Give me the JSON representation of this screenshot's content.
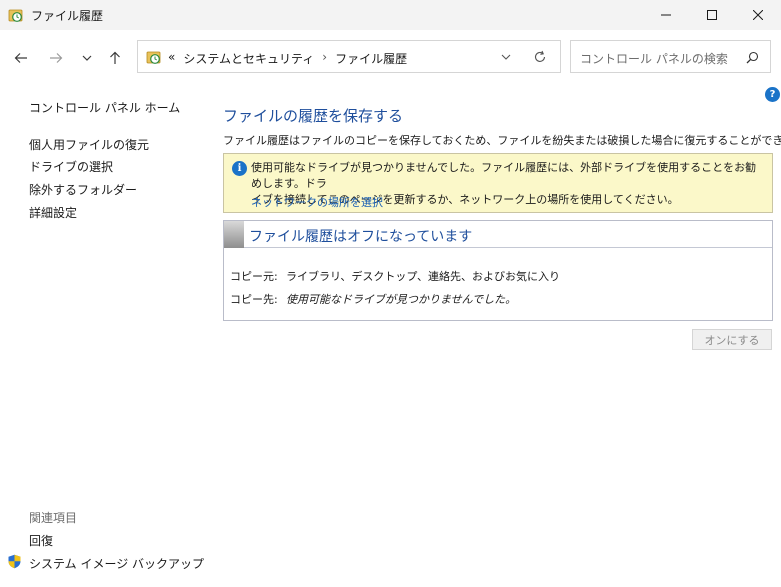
{
  "window": {
    "title": "ファイル履歴",
    "controls": [
      "minimize-icon",
      "maximize-icon",
      "close-icon"
    ]
  },
  "navigation": {
    "back_icon": "arrow-left-icon",
    "forward_icon": "arrow-right-icon",
    "recent_icon": "chevron-down-icon",
    "up_icon": "arrow-up-icon",
    "breadcrumb": {
      "overflow": "«",
      "items": [
        "システムとセキュリティ",
        "ファイル履歴"
      ],
      "separator": "›"
    },
    "search_placeholder": "コントロール パネルの検索"
  },
  "sidebar": {
    "home": "コントロール パネル ホーム",
    "items": [
      "個人用ファイルの復元",
      "ドライブの選択",
      "除外するフォルダー",
      "詳細設定"
    ],
    "related_title": "関連項目",
    "related_items": [
      "回復",
      "システム イメージ バックアップ"
    ]
  },
  "main": {
    "help": "?",
    "title": "ファイルの履歴を保存する",
    "description": "ファイル履歴はファイルのコピーを保存しておくため、ファイルを紛失または破損した場合に復元することができます。",
    "info": {
      "line1": "使用可能なドライブが見つかりませんでした。ファイル履歴には、外部ドライブを使用することをお勧めします。ドラ",
      "line2": "イブを接続してこのページを更新するか、ネットワーク上の場所を使用してください。",
      "link": "ネットワークの場所を選択"
    },
    "status": {
      "title": "ファイル履歴はオフになっています",
      "copy_from_label": "コピー元:",
      "copy_from_value": "ライブラリ、デスクトップ、連絡先、およびお気に入り",
      "copy_to_label": "コピー先:",
      "copy_to_value": "使用可能なドライブが見つかりませんでした。"
    },
    "turn_on_button": "オンにする"
  },
  "colors": {
    "title_blue": "#1e4e9c",
    "link_blue": "#1a5fb4",
    "info_bg": "#fbf8c9",
    "titlebar_bg": "#f3f3f3"
  }
}
